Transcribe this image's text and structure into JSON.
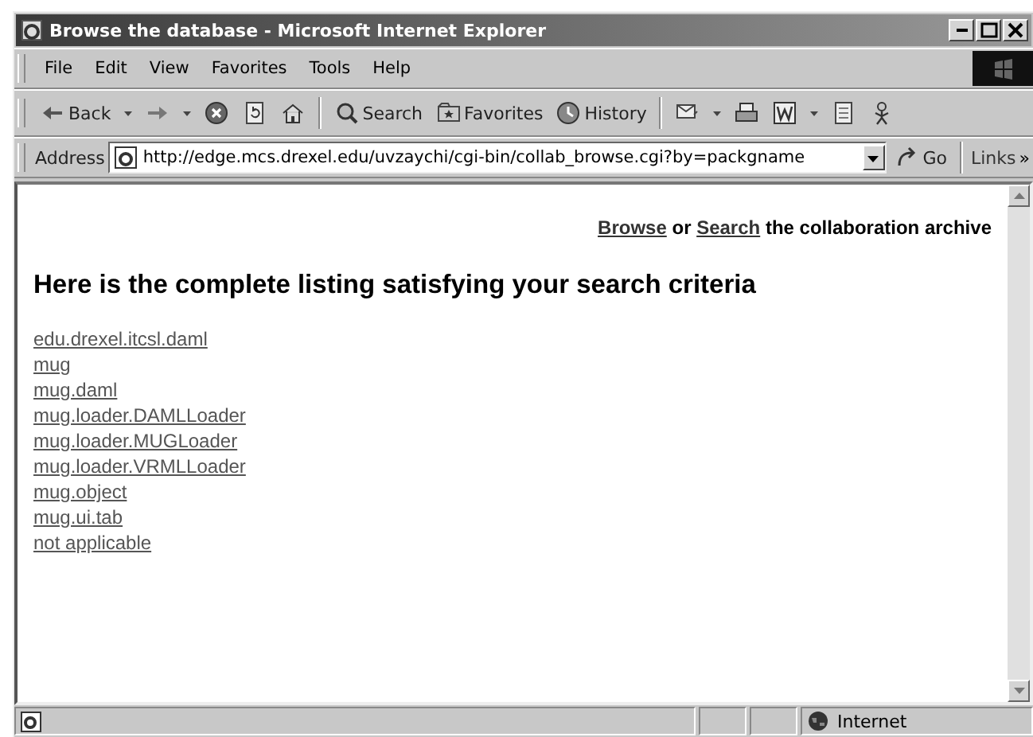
{
  "window": {
    "title": "Browse the database - Microsoft Internet Explorer"
  },
  "menu": [
    "File",
    "Edit",
    "View",
    "Favorites",
    "Tools",
    "Help"
  ],
  "toolbar": [
    {
      "kind": "back",
      "label": "Back"
    },
    {
      "kind": "forward"
    },
    {
      "kind": "stop"
    },
    {
      "kind": "refresh"
    },
    {
      "kind": "home"
    },
    {
      "kind": "sep"
    },
    {
      "kind": "search",
      "label": "Search"
    },
    {
      "kind": "favorites",
      "label": "Favorites"
    },
    {
      "kind": "history",
      "label": "History"
    },
    {
      "kind": "sep"
    },
    {
      "kind": "mail"
    },
    {
      "kind": "print"
    },
    {
      "kind": "edit"
    },
    {
      "kind": "discuss"
    },
    {
      "kind": "messenger"
    }
  ],
  "address": {
    "label": "Address",
    "url": "http://edge.mcs.drexel.edu/uvzaychi/cgi-bin/collab_browse.cgi?by=packgname",
    "go": "Go",
    "links": "Links",
    "more": "»"
  },
  "page": {
    "nav": [
      {
        "kind": "link",
        "text": "Browse"
      },
      {
        "kind": "text",
        "text": "or"
      },
      {
        "kind": "link",
        "text": "Search"
      },
      {
        "kind": "text",
        "text": "the collaboration archive"
      }
    ],
    "heading": "Here is the complete listing satisfying your search criteria",
    "packages": [
      "edu.drexel.itcsl.daml",
      "mug",
      "mug.daml",
      "mug.loader.DAMLLoader",
      "mug.loader.MUGLoader",
      "mug.loader.VRMLLoader",
      "mug.object",
      "mug.ui.tab",
      "not applicable"
    ]
  },
  "status_bar": {
    "zone": "Internet"
  }
}
